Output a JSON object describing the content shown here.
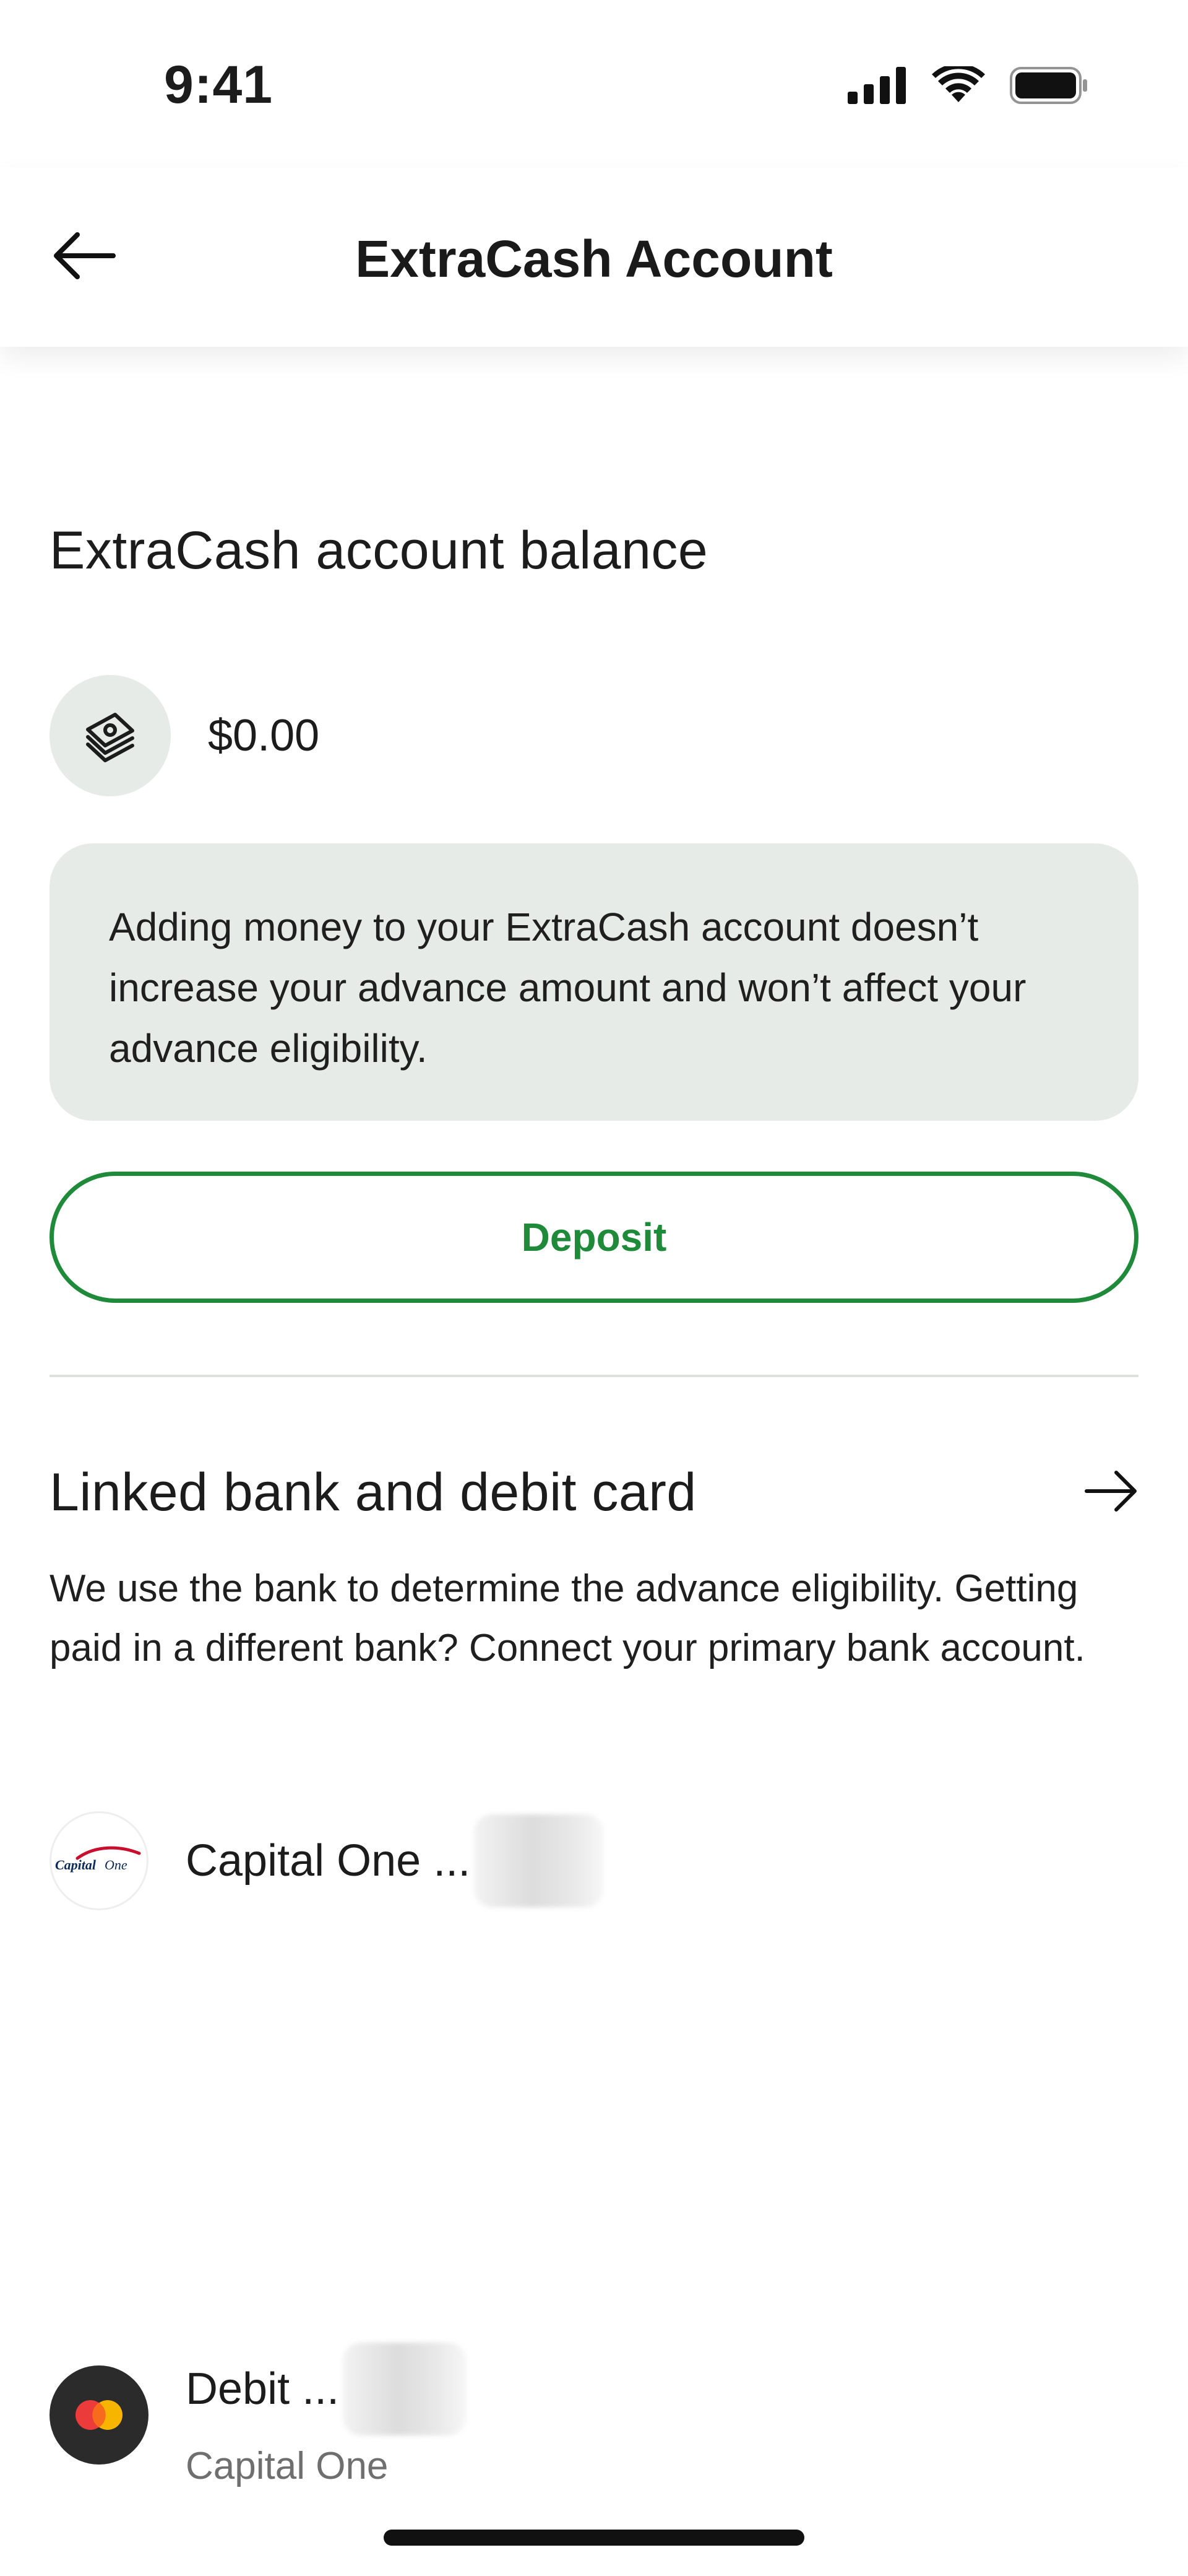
{
  "status_bar": {
    "time": "9:41",
    "icons": [
      "cellular-signal-icon",
      "wifi-icon",
      "battery-icon"
    ]
  },
  "nav": {
    "title": "ExtraCash Account",
    "back_icon": "back-arrow-icon"
  },
  "balance": {
    "title": "ExtraCash account balance",
    "icon": "money-stack-icon",
    "amount": "$0.00",
    "info_text": "Adding money to your ExtraCash account doesn’t increase your advance amount and won’t affect your advance eligibility.",
    "deposit_label": "Deposit"
  },
  "linked": {
    "title": "Linked bank and debit card",
    "arrow_icon": "arrow-right-icon",
    "description": "We use the bank to determine the advance eligibility. Getting paid in a different bank? Connect your primary bank account.",
    "accounts": [
      {
        "icon": "capital-one-logo-icon",
        "name": "Capital One ...",
        "subtitle": ""
      },
      {
        "icon": "mastercard-icon",
        "name": "Debit ...",
        "subtitle": "Capital One"
      }
    ]
  },
  "colors": {
    "accent_green": "#1f8a3a",
    "card_background": "#e6ebe8",
    "text_primary": "#1c1c1c",
    "text_secondary": "#6f6f6f"
  }
}
